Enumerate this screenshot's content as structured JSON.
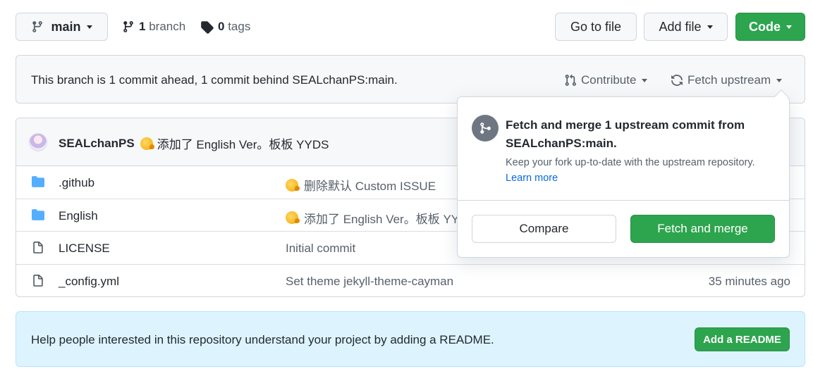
{
  "toolbar": {
    "branch_name": "main",
    "branch_count": "1",
    "branch_word": "branch",
    "tag_count": "0",
    "tag_word": "tags",
    "go_to_file": "Go to file",
    "add_file": "Add file",
    "code": "Code"
  },
  "banner": {
    "status": "This branch is 1 commit ahead, 1 commit behind SEALchanPS:main.",
    "contribute": "Contribute",
    "fetch_upstream": "Fetch upstream"
  },
  "latest_commit": {
    "author": "SEALchanPS",
    "message": "添加了 English Ver。板板 YYDS"
  },
  "files": [
    {
      "name": ".github",
      "type": "folder",
      "message": "删除默认 Custom ISSUE",
      "emoji": true,
      "time": ""
    },
    {
      "name": "English",
      "type": "folder",
      "message": "添加了 English Ver。板板 YYDS",
      "emoji": true,
      "time": ""
    },
    {
      "name": "LICENSE",
      "type": "file",
      "message": "Initial commit",
      "emoji": false,
      "time": ""
    },
    {
      "name": "_config.yml",
      "type": "file",
      "message": "Set theme jekyll-theme-cayman",
      "emoji": false,
      "time": "35 minutes ago"
    }
  ],
  "popover": {
    "title": "Fetch and merge 1 upstream commit from SEALchanPS:main.",
    "description": "Keep your fork up-to-date with the upstream repository.",
    "learn_more": "Learn more",
    "compare": "Compare",
    "fetch_and_merge": "Fetch and merge"
  },
  "readme": {
    "text": "Help people interested in this repository understand your project by adding a README.",
    "button": "Add a README"
  },
  "colors": {
    "green": "#2da44e",
    "folder_blue": "#54aeff",
    "link_blue": "#0969da",
    "readme_bg": "#ddf4ff"
  }
}
